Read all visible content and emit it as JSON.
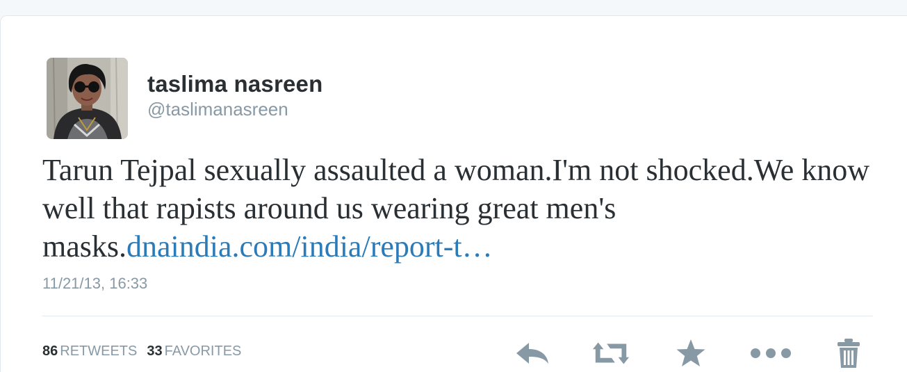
{
  "tweet": {
    "display_name": "taslima nasreen",
    "handle": "@taslimanasreen",
    "text_before_link": "Tarun Tejpal sexually assaulted a woman.I'm not shocked.We know well that rapists around us wearing great men's masks.",
    "link_text": "dnaindia.com/india/report-t…",
    "timestamp": "11/21/13, 16:33"
  },
  "stats": {
    "retweets_count": "86",
    "retweets_label": "RETWEETS",
    "favorites_count": "33",
    "favorites_label": "FAVORITES"
  },
  "actions": {
    "icons": [
      "reply-icon",
      "retweet-icon",
      "favorite-star-icon",
      "more-options-icon",
      "delete-trash-icon"
    ]
  },
  "colors": {
    "link": "#2b7bb9",
    "text": "#292f33",
    "muted": "#8899a6",
    "icon": "#8899a6"
  }
}
